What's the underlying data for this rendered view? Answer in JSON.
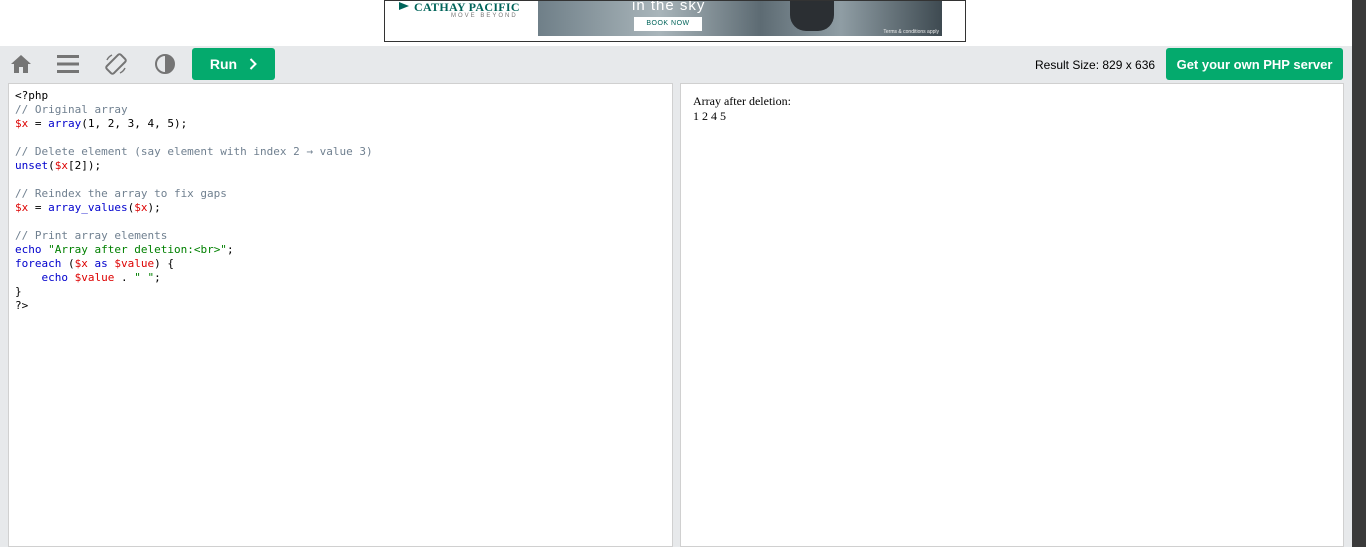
{
  "ad": {
    "brand": "CATHAY PACIFIC",
    "tagline": "MOVE BEYOND",
    "headline": "in the sky",
    "cta": "BOOK NOW",
    "terms": "Terms & conditions apply"
  },
  "toolbar": {
    "home_icon": "home-icon",
    "menu_icon": "menu-icon",
    "rotate_icon": "rotate-icon",
    "theme_icon": "contrast-icon",
    "run_label": "Run",
    "run_icon": "chevron-right-icon",
    "result_size": "Result Size: 829 x 636",
    "get_server_label": "Get your own PHP server"
  },
  "editor": {
    "lines": [
      "<?php",
      "// Original array",
      "$x = array(1, 2, 3, 4, 5);",
      "",
      "// Delete element (say element with index 2 → value 3)",
      "unset($x[2]);",
      "",
      "// Reindex the array to fix gaps",
      "$x = array_values($x);",
      "",
      "// Print array elements",
      "echo \"Array after deletion:<br>\";",
      "foreach ($x as $value) {",
      "    echo $value . \" \";",
      "}",
      "?>"
    ]
  },
  "result": {
    "line1": "Array after deletion:",
    "line2": "1 2 4 5"
  },
  "colors": {
    "accent": "#04aa6d",
    "toolbar_bg": "#e7e9eb",
    "code_comment": "#708090",
    "code_variable": "#dd0000",
    "code_keyword": "#0000cd"
  }
}
